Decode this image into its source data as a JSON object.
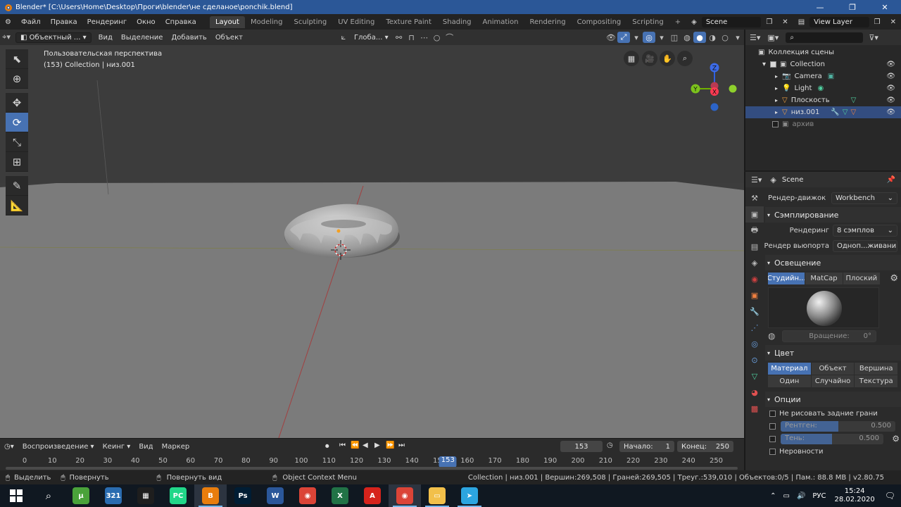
{
  "window": {
    "title": "Blender* [C:\\Users\\Home\\Desktop\\Проги\\blender\\не сделаное\\ponchik.blend]"
  },
  "menu": [
    "Файл",
    "Правка",
    "Рендеринг",
    "Окно",
    "Справка"
  ],
  "workspaces": [
    "Layout",
    "Modeling",
    "Sculpting",
    "UV Editing",
    "Texture Paint",
    "Shading",
    "Animation",
    "Rendering",
    "Compositing",
    "Scripting"
  ],
  "active_workspace": "Layout",
  "scene_name": "Scene",
  "view_layer": "View Layer",
  "viewport_header": {
    "mode": "Объектный ...",
    "view": "Вид",
    "select": "Выделение",
    "add": "Добавить",
    "object": "Объект",
    "transform_orientation": "Глоба..."
  },
  "viewport": {
    "perspective_label": "Пользовательская перспектива",
    "collection_label": "(153) Collection | низ.001"
  },
  "gizmo": {
    "x": "X",
    "y": "Y",
    "z": "Z"
  },
  "outliner": {
    "root": "Коллекция сцены",
    "items": [
      {
        "label": "Collection",
        "checked": true
      },
      {
        "label": "Camera"
      },
      {
        "label": "Light"
      },
      {
        "label": "Плоскость"
      },
      {
        "label": "низ.001",
        "selected": true
      },
      {
        "label": "архив",
        "checked": false
      }
    ]
  },
  "properties": {
    "header": "Scene",
    "render_engine_label": "Рендер-движок",
    "render_engine": "Workbench",
    "sampling_section": "Сэмплирование",
    "render_label": "Рендеринг",
    "render_value": "8 сэмплов",
    "viewport_render_label": "Рендер вьюпорта",
    "viewport_render_value": "Одноп...живани",
    "lighting_section": "Освещение",
    "lighting_options": [
      "Студийн...",
      "MatCap",
      "Плоский"
    ],
    "rotation_label": "Вращение:",
    "rotation_value": "0°",
    "color_section": "Цвет",
    "color_options": [
      "Материал",
      "Объект",
      "Вершина",
      "Один",
      "Случайно",
      "Текстура"
    ],
    "options_section": "Опции",
    "backface_label": "Не рисовать задние грани",
    "xray_label": "Рентген:",
    "xray_value": "0.500",
    "shadow_label": "Тень:",
    "shadow_value": "0.500",
    "cavity_label": "Неровности"
  },
  "timeline": {
    "playback": "Воспроизведение",
    "keying": "Кеинг",
    "view": "Вид",
    "marker": "Маркер",
    "current_frame": "153",
    "start_label": "Начало:",
    "start": "1",
    "end_label": "Конец:",
    "end": "250",
    "ticks": [
      "0",
      "10",
      "20",
      "30",
      "40",
      "50",
      "60",
      "70",
      "80",
      "90",
      "100",
      "110",
      "120",
      "130",
      "140",
      "150",
      "160",
      "170",
      "180",
      "190",
      "200",
      "210",
      "220",
      "230",
      "240",
      "250"
    ]
  },
  "statusbar": {
    "select": "Выделить",
    "rotate": "Повернуть",
    "rotate_view": "Повернуть вид",
    "context": "Object Context Menu",
    "stats": "Collection | низ.001 | Вершин:269,508 | Граней:269,505 | Треуг.:539,010 | Объектов:0/5 | Пам.: 88.8 MB | v2.80.75"
  },
  "taskbar": {
    "apps": [
      {
        "name": "utorrent",
        "label": "µ",
        "color": "#4aa23a"
      },
      {
        "name": "calendar",
        "label": "321",
        "color": "#2a6cb0"
      },
      {
        "name": "media-player",
        "label": "▦",
        "color": "#1e1e1e"
      },
      {
        "name": "pycharm",
        "label": "PC",
        "color": "#21d789"
      },
      {
        "name": "blender",
        "label": "B",
        "color": "#e87d0d"
      },
      {
        "name": "photoshop",
        "label": "Ps",
        "color": "#001d34"
      },
      {
        "name": "word",
        "label": "W",
        "color": "#2b579a"
      },
      {
        "name": "chrome",
        "label": "◉",
        "color": "#db4437"
      },
      {
        "name": "excel",
        "label": "X",
        "color": "#217346"
      },
      {
        "name": "acrobat",
        "label": "A",
        "color": "#d6231c"
      },
      {
        "name": "chrome-2",
        "label": "◉",
        "color": "#db4437"
      },
      {
        "name": "explorer",
        "label": "▭",
        "color": "#f2c04a"
      },
      {
        "name": "telegram",
        "label": "➤",
        "color": "#2ca5e0"
      }
    ],
    "language": "РУС",
    "time": "15:24",
    "date": "28.02.2020"
  }
}
